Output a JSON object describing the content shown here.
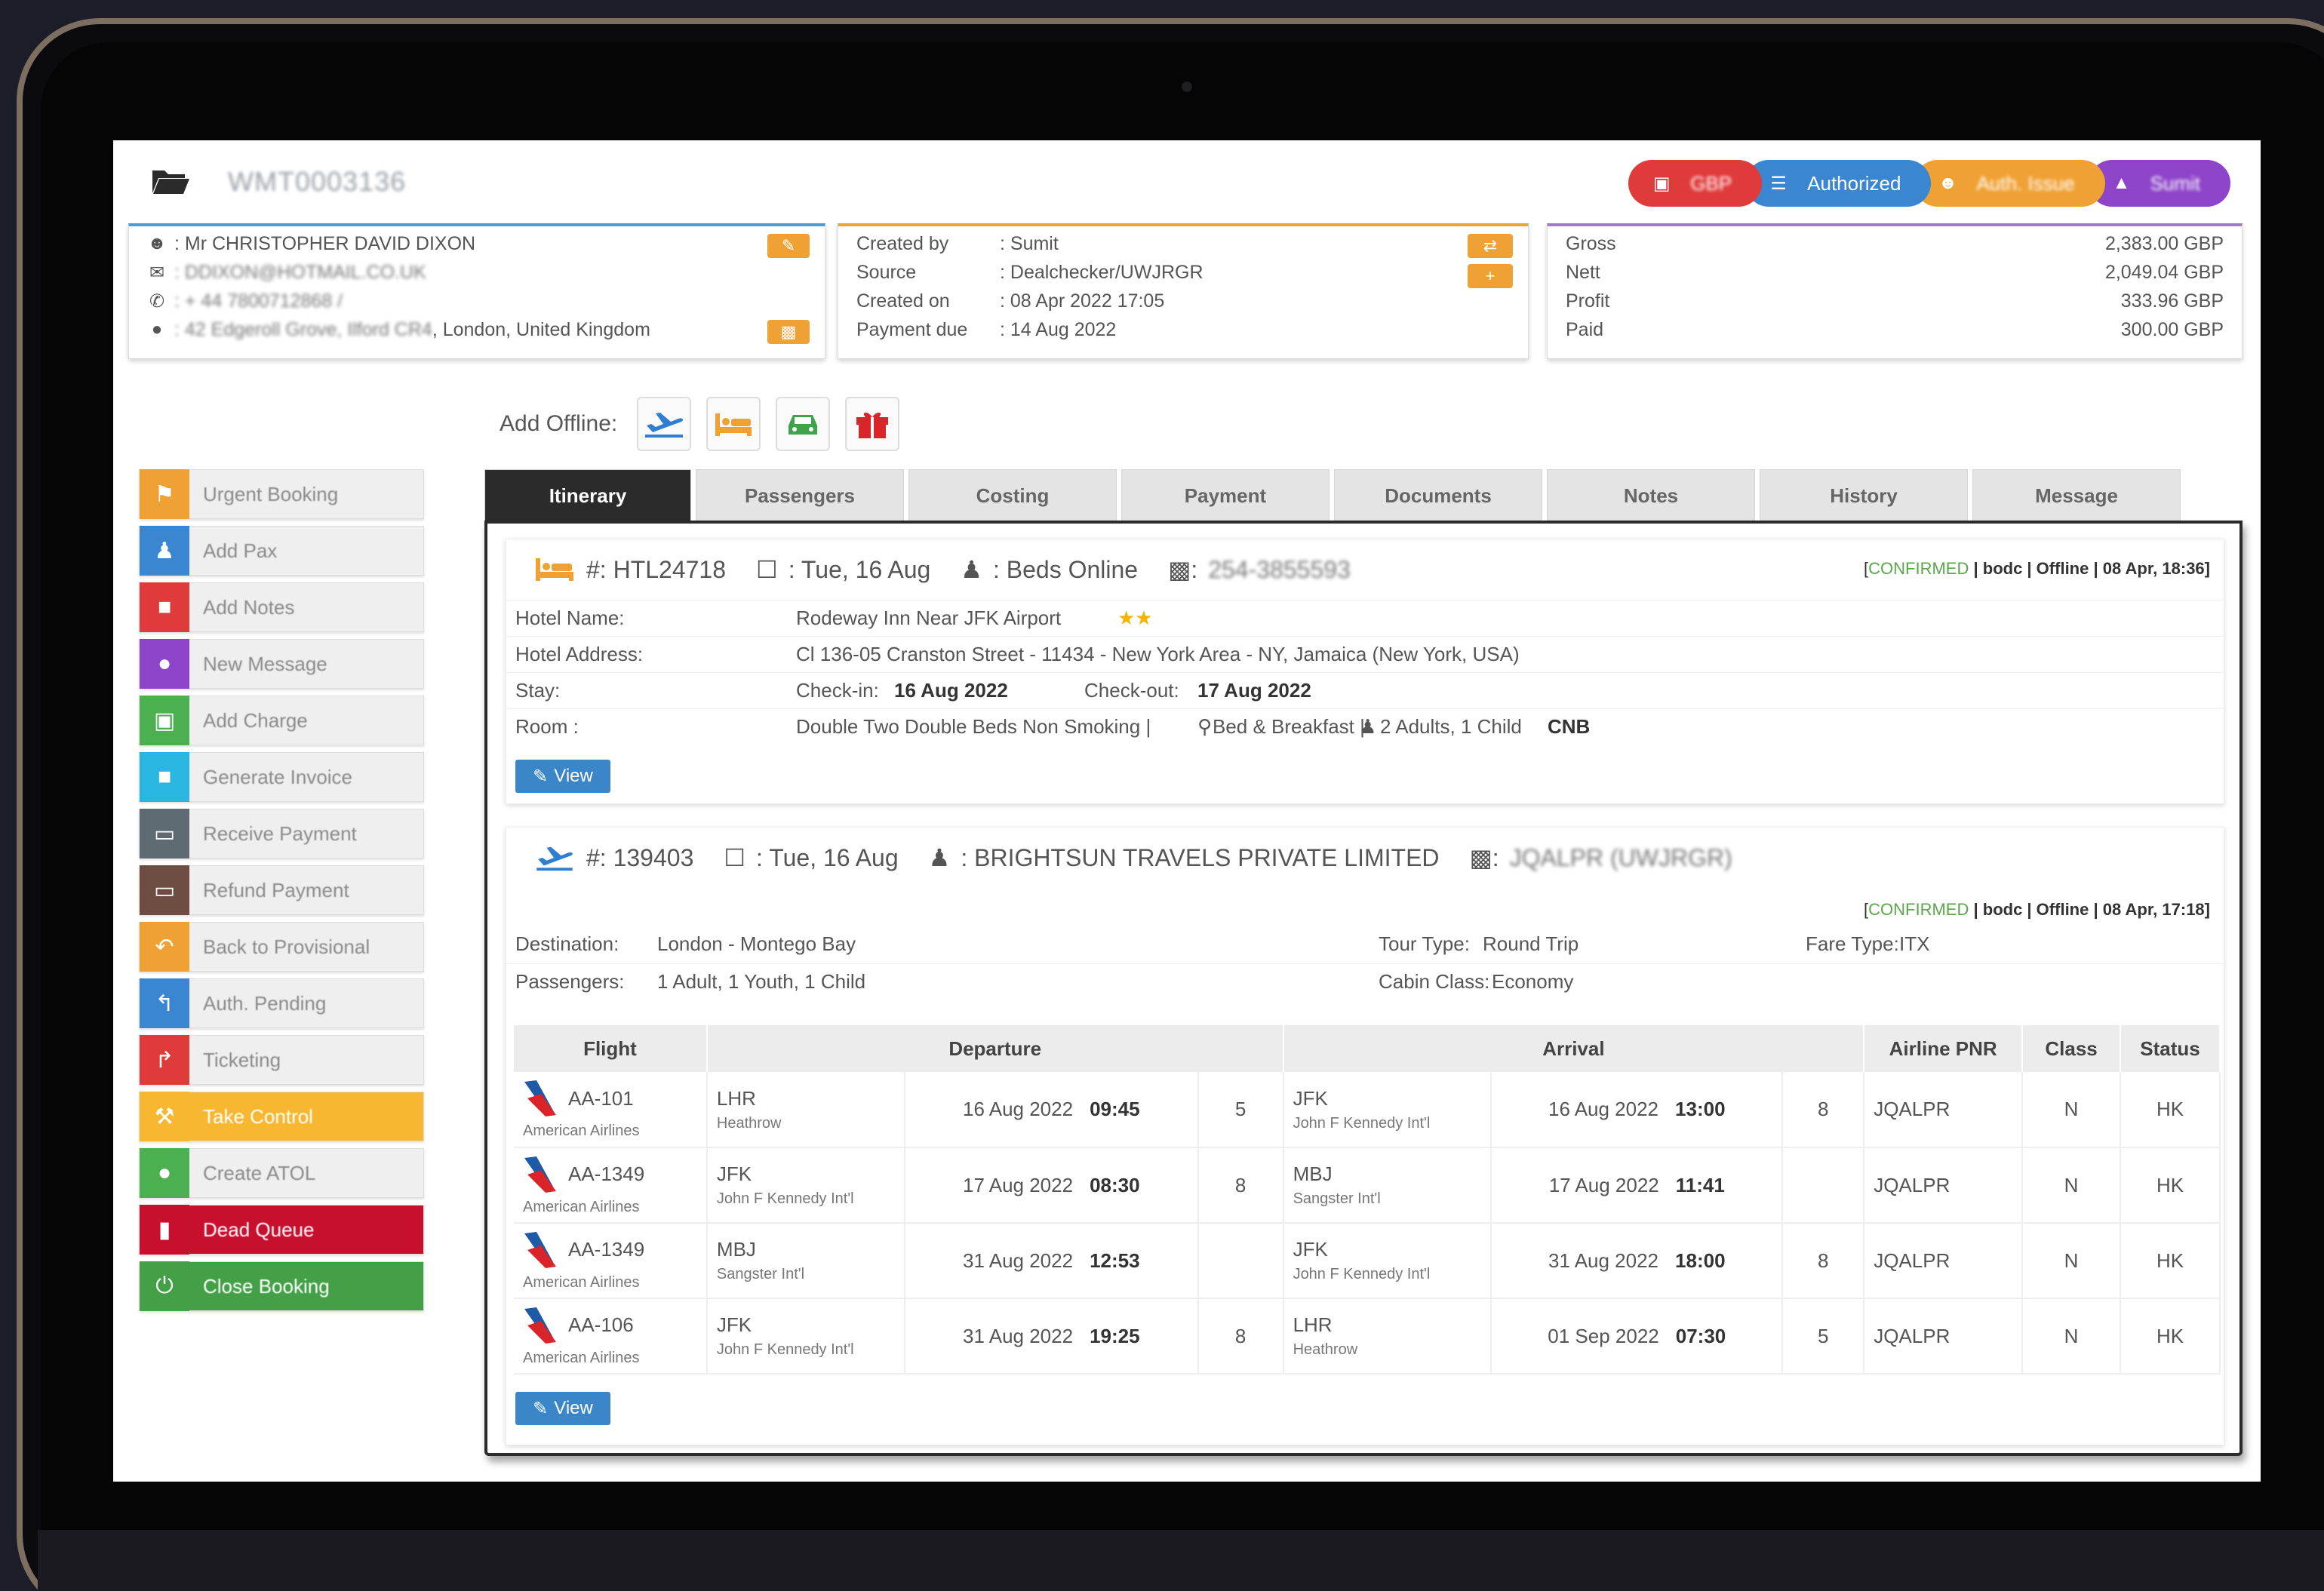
{
  "header": {
    "booking_ref": "WMT0003136"
  },
  "status_pills": [
    {
      "label": "GBP",
      "color": "#e03b3b",
      "icon": "money-icon",
      "blurred": true
    },
    {
      "label": "Authorized",
      "color": "#3a86d1",
      "icon": "list-icon",
      "blurred": false
    },
    {
      "label": "Auth. Issue",
      "color": "#f0a134",
      "icon": "user-icon",
      "blurred": true
    },
    {
      "label": "Sumit",
      "color": "#8e44c9",
      "icon": "lock-icon",
      "blurred": true
    }
  ],
  "customer": {
    "name": ": Mr CHRISTOPHER DAVID DIXON",
    "email": ": DDIXON@HOTMAIL.CO.UK",
    "phone": ": + 44 7800712868 /",
    "address_blur": ": 42 Edgeroll Grove, Ilford CR4",
    "address_visible": ", London, United Kingdom"
  },
  "booking_meta": {
    "rows": [
      {
        "label": "Created by",
        "value": ": Sumit"
      },
      {
        "label": "Source",
        "value": ": Dealchecker/UWJRGR"
      },
      {
        "label": "Created on",
        "value": ": 08 Apr 2022 17:05"
      },
      {
        "label": "Payment due",
        "value": ": 14 Aug 2022"
      }
    ]
  },
  "totals": {
    "rows": [
      {
        "label": "Gross",
        "value": "2,383.00 GBP"
      },
      {
        "label": "Nett",
        "value": "2,049.04 GBP"
      },
      {
        "label": "Profit",
        "value": "333.96 GBP"
      },
      {
        "label": "Paid",
        "value": "300.00 GBP"
      }
    ]
  },
  "add_offline": {
    "label": "Add Offline:"
  },
  "sidebar": [
    {
      "label": "Urgent Booking",
      "color": "#f0a134",
      "icon": "flag-icon",
      "full": false
    },
    {
      "label": "Add Pax",
      "color": "#3a86d1",
      "icon": "users-icon",
      "full": false
    },
    {
      "label": "Add Notes",
      "color": "#e03b3b",
      "icon": "file-icon",
      "full": false
    },
    {
      "label": "New Message",
      "color": "#8e44c9",
      "icon": "chat-icon",
      "full": false
    },
    {
      "label": "Add Charge",
      "color": "#4caf50",
      "icon": "money-icon",
      "full": false
    },
    {
      "label": "Generate Invoice",
      "color": "#29b6e0",
      "icon": "document-icon",
      "full": false
    },
    {
      "label": "Receive Payment",
      "color": "#5f6b73",
      "icon": "card-icon",
      "full": false
    },
    {
      "label": "Refund Payment",
      "color": "#6d4c41",
      "icon": "card-icon",
      "full": false
    },
    {
      "label": "Back to Provisional",
      "color": "#f0a134",
      "icon": "undo-icon",
      "full": false
    },
    {
      "label": "Auth. Pending",
      "color": "#3a86d1",
      "icon": "reply-icon",
      "full": false
    },
    {
      "label": "Ticketing",
      "color": "#e03b3b",
      "icon": "share-icon",
      "full": false
    },
    {
      "label": "Take Control",
      "color": "#f7b731",
      "icon": "wrench-icon",
      "full": true
    },
    {
      "label": "Create ATOL",
      "color": "#4caf50",
      "icon": "circle-icon",
      "full": false
    },
    {
      "label": "Dead Queue",
      "color": "#c8102e",
      "icon": "trash-icon",
      "full": true
    },
    {
      "label": "Close Booking",
      "color": "#43a047",
      "icon": "power-icon",
      "full": true
    }
  ],
  "tabs": [
    "Itinerary",
    "Passengers",
    "Costing",
    "Payment",
    "Documents",
    "Notes",
    "History",
    "Message"
  ],
  "hotel": {
    "ref": "#: HTL24718",
    "date": ": Tue, 16 Aug",
    "supplier": ": Beds Online",
    "supplier_ref_blur": "254-3855593",
    "status": {
      "confirmed": "CONFIRMED",
      "rest": " | bodc | Offline | 08 Apr, 18:36]",
      "open": "["
    },
    "name_label": "Hotel Name:",
    "name": "Rodeway Inn Near JFK Airport",
    "stars": "★★",
    "address_label": "Hotel Address:",
    "address": "Cl 136-05 Cranston Street - 11434 - New York Area - NY, Jamaica (New York, USA)",
    "stay_label": "Stay:",
    "checkin_label": "Check-in:",
    "checkin": "16 Aug 2022",
    "checkout_label": "Check-out:",
    "checkout": "17 Aug 2022",
    "room_label": "Room :",
    "room": "Double Two Double Beds Non Smoking |",
    "board": "Bed & Breakfast |",
    "occupancy": "2 Adults, 1 Child",
    "cnb": "CNB",
    "view_label": "View"
  },
  "flight": {
    "ref": "#: 139403",
    "date": ": Tue, 16 Aug",
    "supplier": ": BRIGHTSUN TRAVELS PRIVATE LIMITED",
    "supplier_ref_blur": "JQALPR (UWJRGR)",
    "status": {
      "open": "[",
      "confirmed": "CONFIRMED",
      "rest": " | bodc | Offline | 08 Apr, 17:18]"
    },
    "destination_label": "Destination:",
    "destination": "London - Montego Bay",
    "tour_label": "Tour Type:",
    "tour": "Round Trip",
    "fare_label": "Fare Type:",
    "fare": "ITX",
    "pax_label": "Passengers:",
    "pax": "1 Adult, 1 Youth, 1 Child",
    "cabin_label": "Cabin Class:",
    "cabin": "Economy",
    "columns": [
      "Flight",
      "Departure",
      "Arrival",
      "Airline PNR",
      "Class",
      "Status"
    ],
    "segments": [
      {
        "flight": "AA-101",
        "airline": "American Airlines",
        "dep_code": "LHR",
        "dep_name": "Heathrow",
        "dep_date": "16 Aug 2022",
        "dep_time": "09:45",
        "dep_term": "5",
        "arr_code": "JFK",
        "arr_name": "John F Kennedy Int'l",
        "arr_date": "16 Aug 2022",
        "arr_time": "13:00",
        "arr_term": "8",
        "pnr": "JQALPR",
        "cls": "N",
        "status": "HK"
      },
      {
        "flight": "AA-1349",
        "airline": "American Airlines",
        "dep_code": "JFK",
        "dep_name": "John F Kennedy Int'l",
        "dep_date": "17 Aug 2022",
        "dep_time": "08:30",
        "dep_term": "8",
        "arr_code": "MBJ",
        "arr_name": "Sangster Int'l",
        "arr_date": "17 Aug 2022",
        "arr_time": "11:41",
        "arr_term": "",
        "pnr": "JQALPR",
        "cls": "N",
        "status": "HK"
      },
      {
        "flight": "AA-1349",
        "airline": "American Airlines",
        "dep_code": "MBJ",
        "dep_name": "Sangster Int'l",
        "dep_date": "31 Aug 2022",
        "dep_time": "12:53",
        "dep_term": "",
        "arr_code": "JFK",
        "arr_name": "John F Kennedy Int'l",
        "arr_date": "31 Aug 2022",
        "arr_time": "18:00",
        "arr_term": "8",
        "pnr": "JQALPR",
        "cls": "N",
        "status": "HK"
      },
      {
        "flight": "AA-106",
        "airline": "American Airlines",
        "dep_code": "JFK",
        "dep_name": "John F Kennedy Int'l",
        "dep_date": "31 Aug 2022",
        "dep_time": "19:25",
        "dep_term": "8",
        "arr_code": "LHR",
        "arr_name": "Heathrow",
        "arr_date": "01 Sep 2022",
        "arr_time": "07:30",
        "arr_term": "5",
        "pnr": "JQALPR",
        "cls": "N",
        "status": "HK"
      }
    ],
    "view_label": "View"
  }
}
